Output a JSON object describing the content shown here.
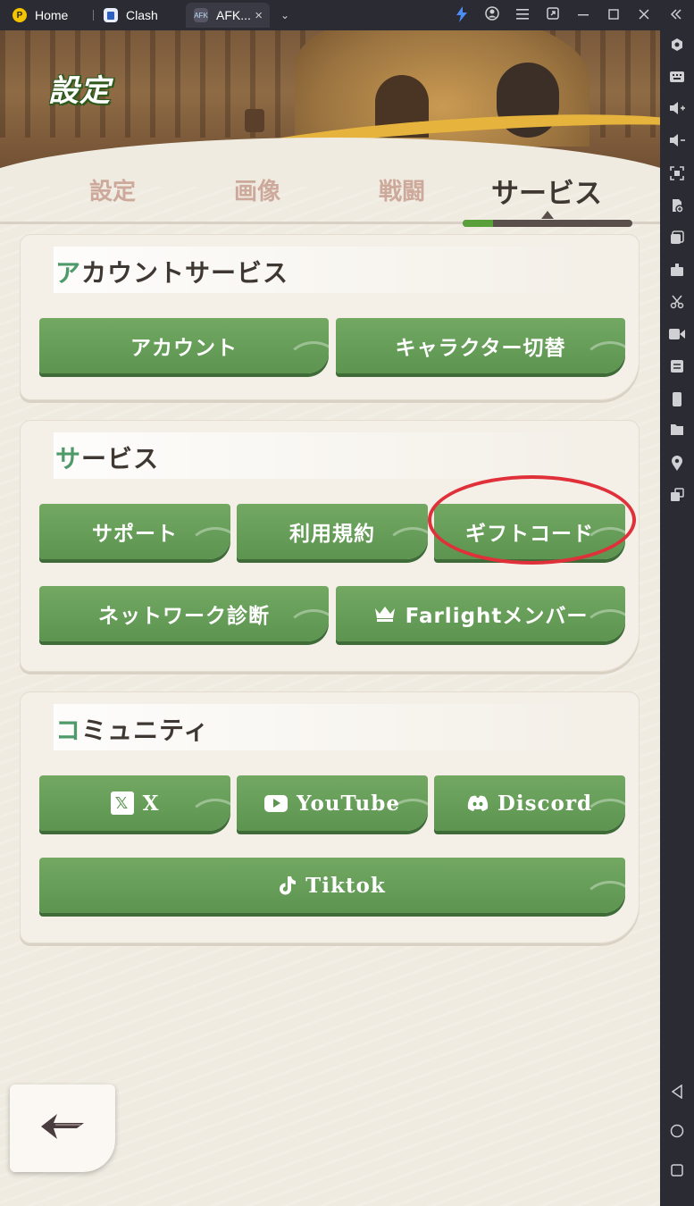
{
  "window": {
    "tabs": [
      {
        "label": "Home"
      },
      {
        "label": "Clash"
      },
      {
        "label": "AFK..."
      }
    ],
    "close_tab_glyph": "×",
    "toolbar_icons": [
      "flash-icon",
      "account-icon",
      "menu-icon",
      "popout-icon",
      "minimize-icon",
      "maximize-icon",
      "close-icon",
      "collapse-sidebar-icon"
    ]
  },
  "sidebar": {
    "icons": [
      "settings-gear-icon",
      "keyboard-icon",
      "volume-up-icon",
      "volume-down-icon",
      "screenshot-icon",
      "apk-install-icon",
      "multi-instance-icon",
      "macro-icon",
      "scissors-icon",
      "record-icon",
      "sync-icon",
      "rotate-icon",
      "folder-icon",
      "location-icon",
      "multi-window-icon",
      "back-nav-icon",
      "home-nav-icon",
      "recent-nav-icon"
    ]
  },
  "game": {
    "title": "設定",
    "tabs": [
      {
        "label": "設定"
      },
      {
        "label": "画像"
      },
      {
        "label": "戦闘"
      },
      {
        "label": "サービス",
        "active": true
      }
    ],
    "sections": {
      "account": {
        "title_first": "ア",
        "title_rest": "カウントサービス",
        "buttons": {
          "account": "アカウント",
          "character_switch": "キャラクター切替"
        }
      },
      "service": {
        "title_first": "サ",
        "title_rest": "ービス",
        "buttons": {
          "support": "サポート",
          "terms": "利用規約",
          "gift_code": "ギフトコード",
          "network": "ネットワーク診断",
          "farlight": "Farlightメンバー"
        }
      },
      "community": {
        "title_first": "コ",
        "title_rest": "ミュニティ",
        "buttons": {
          "x": "X",
          "x_icon": "𝕏",
          "youtube": "YouTube",
          "discord": "Discord",
          "tiktok": "Tiktok"
        }
      }
    },
    "colors": {
      "button_green": "#5c9450",
      "accent_title": "#4e9a6a",
      "highlight_red": "#e0303a"
    }
  }
}
